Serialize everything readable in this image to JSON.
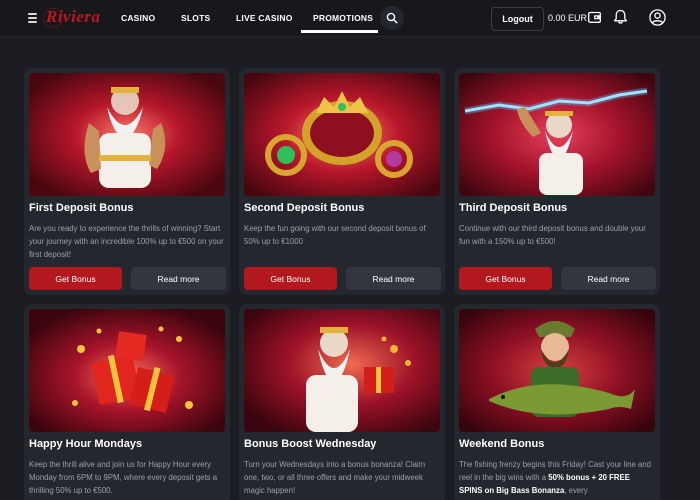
{
  "header": {
    "logo_text": "Riviera",
    "nav": [
      {
        "label": "CASINO"
      },
      {
        "label": "SLOTS"
      },
      {
        "label": "LIVE CASINO"
      },
      {
        "label": "PROMOTIONS",
        "active": true
      }
    ],
    "logout_label": "Logout",
    "balance": "0.00 EUR",
    "icons": {
      "menu": "hamburger-icon",
      "search": "search-icon",
      "wallet": "wallet-icon",
      "notifications": "bell-icon",
      "account": "user-icon"
    }
  },
  "colors": {
    "accent": "#b3181f",
    "background": "#1b1d22",
    "card": "#24272d",
    "secondary_button": "#33363d"
  },
  "promotions": [
    {
      "title": "First Deposit Bonus",
      "description": "Are you ready to experience the thrills of winning? Start your journey with an incredible 100% up to €500 on your first deposit!",
      "primary_label": "Get Bonus",
      "secondary_label": "Read more"
    },
    {
      "title": "Second Deposit Bonus",
      "description": "Keep the fun going with our second deposit bonus of 50% up to €1000",
      "primary_label": "Get Bonus",
      "secondary_label": "Read more"
    },
    {
      "title": "Third Deposit Bonus",
      "description": "Continue with our third deposit bonus and double your fun with a 150% up to €500!",
      "primary_label": "Get Bonus",
      "secondary_label": "Read more"
    },
    {
      "title": "Happy Hour Mondays",
      "description": "Keep the thrill alive and join us for Happy Hour every Monday from 6PM to 9PM, where every deposit gets a thrilling 50% up to €500."
    },
    {
      "title": "Bonus Boost Wednesday",
      "description": "Turn your Wednesdays into a bonus bonanza! Claim one, two, or all three offers and make your midweek magic happen!"
    },
    {
      "title": "Weekend Bonus",
      "description_parts": [
        "The fishing frenzy begins this Friday! Cast your line and reel in the big wins with a ",
        "50% bonus + 20 FREE SPINS on Big Bass Bonanza",
        ", every"
      ]
    }
  ]
}
